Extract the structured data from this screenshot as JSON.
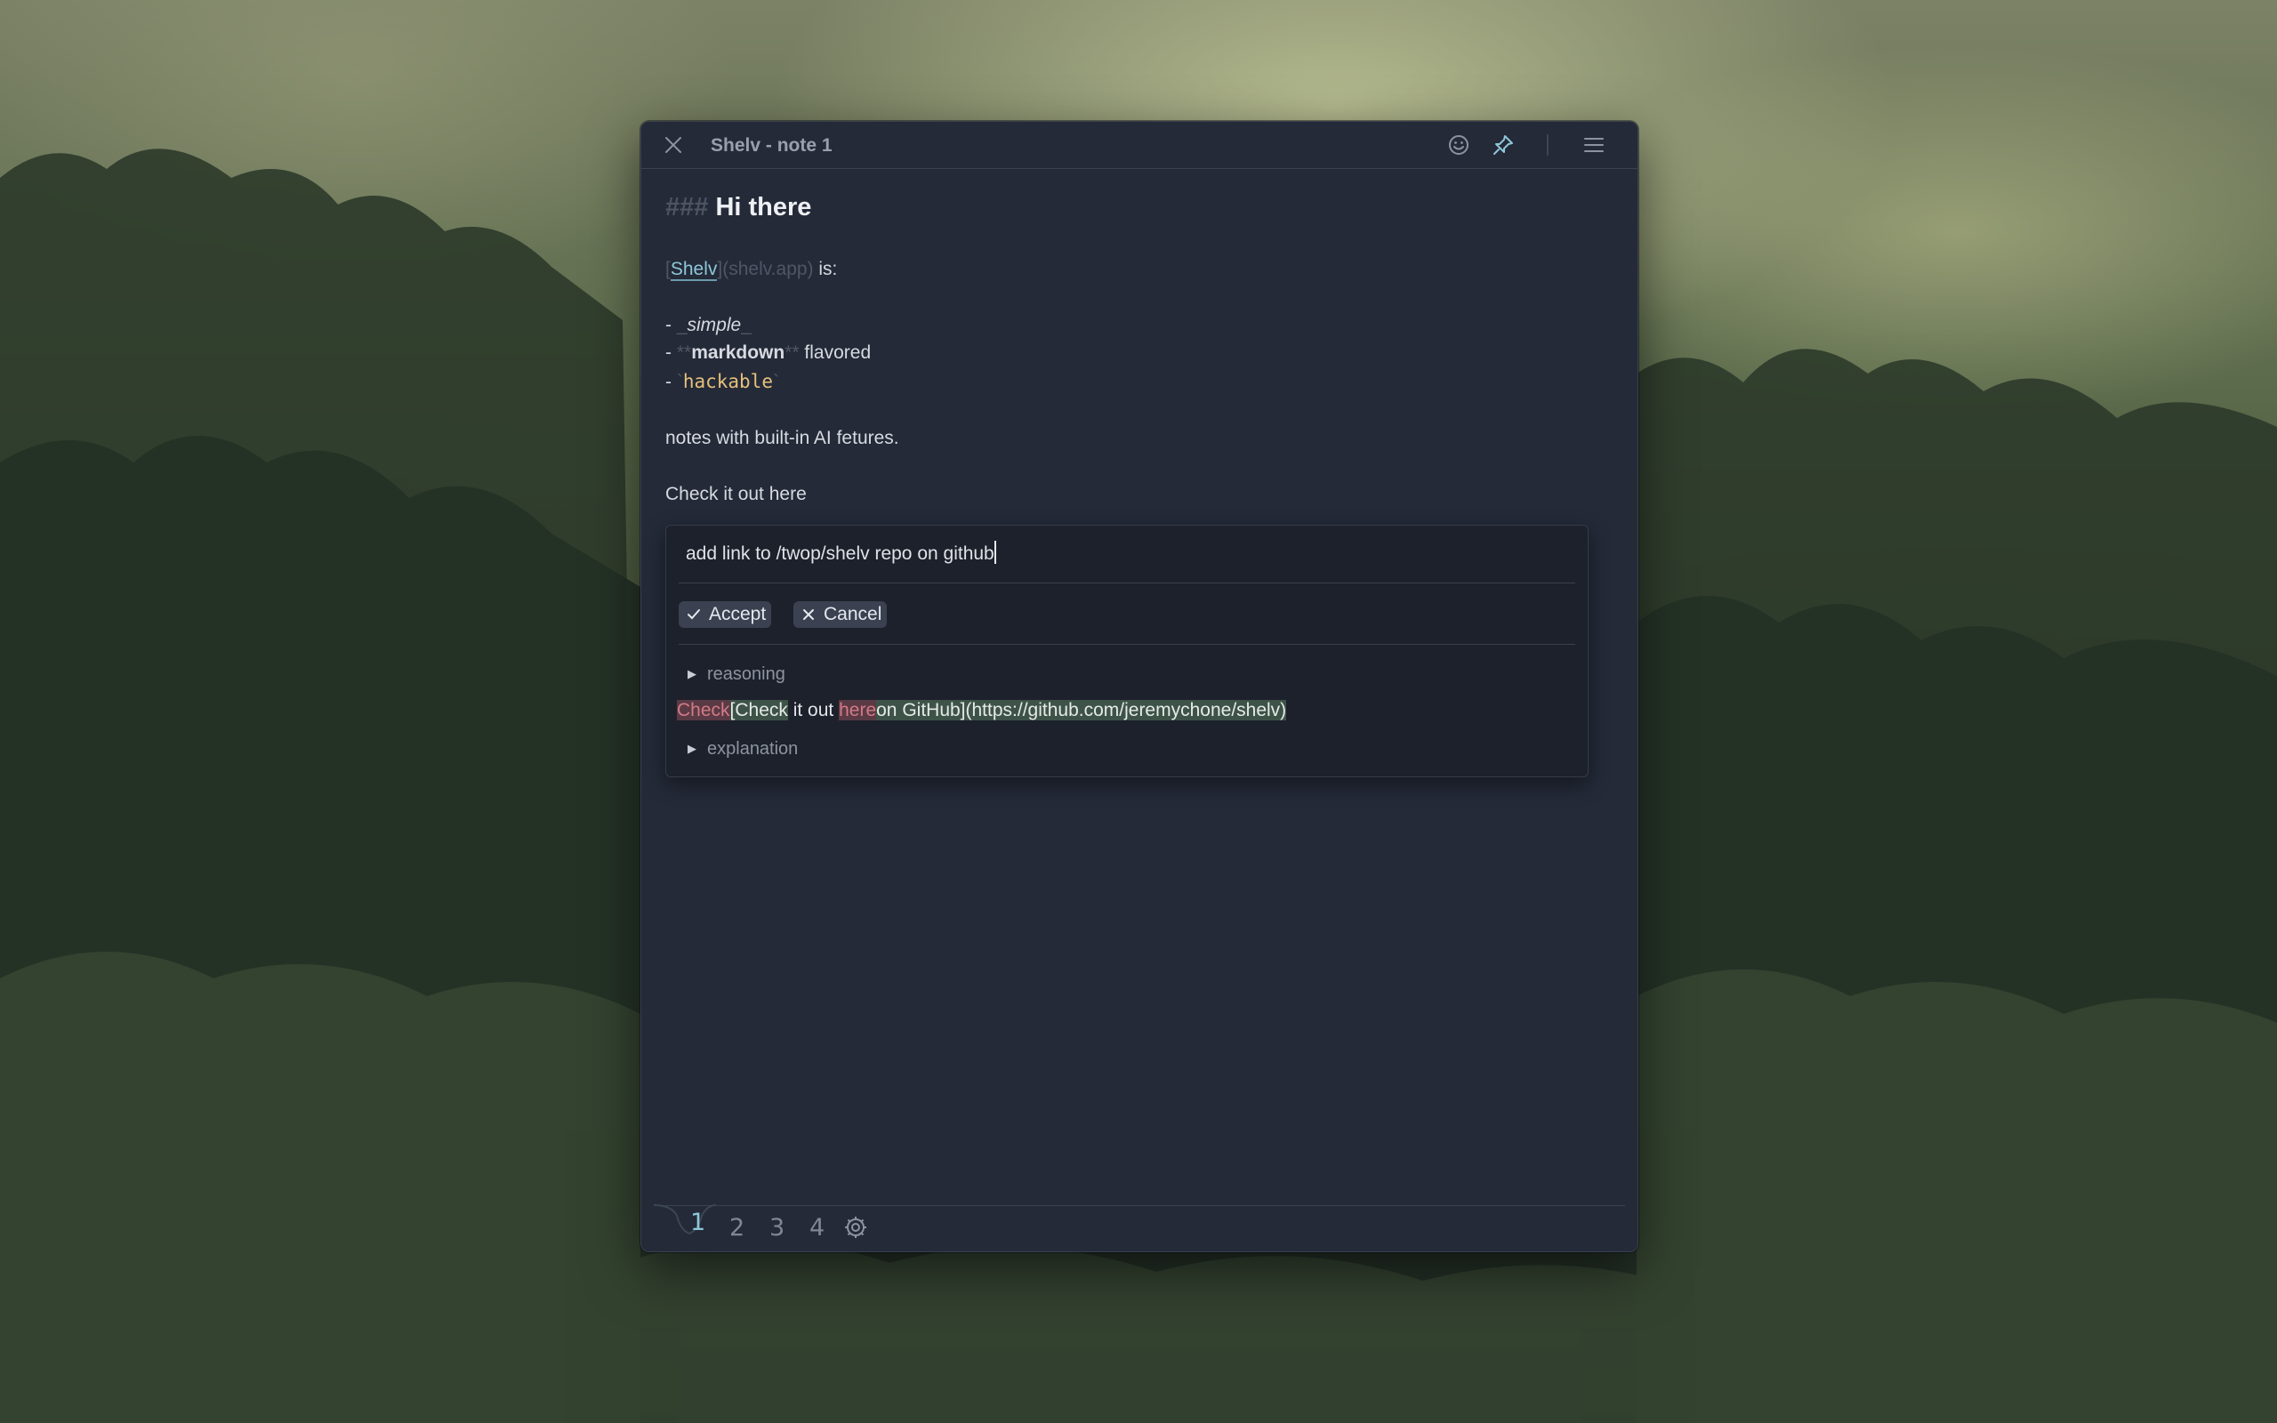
{
  "window": {
    "title": "Shelv - note 1"
  },
  "note": {
    "heading_marker": "###",
    "heading_text": "Hi there",
    "link_open": "[",
    "link_text": "Shelv",
    "link_close": "]",
    "link_url": "(shelv.app)",
    "link_suffix": " is:",
    "items": [
      {
        "bullet": "- ",
        "pre": "_",
        "text": "simple",
        "post": "_"
      },
      {
        "bullet": "- ",
        "pre": "**",
        "text": "markdown",
        "post": "**",
        "suffix": " flavored"
      },
      {
        "bullet": "- ",
        "pre": "`",
        "text": "hackable",
        "post": "`"
      }
    ],
    "paragraph": "notes with built-in AI fetures.",
    "check_line": "Check it out here"
  },
  "ai": {
    "prompt": "add link to /twop/shelv repo on github",
    "accept_label": "Accept",
    "cancel_label": "Cancel",
    "reasoning_label": "reasoning",
    "explanation_label": "explanation",
    "diff": [
      {
        "type": "del",
        "text": "Check"
      },
      {
        "type": "add",
        "text": "[Check"
      },
      {
        "type": "same",
        "text": " it out "
      },
      {
        "type": "del",
        "text": "here"
      },
      {
        "type": "add",
        "text": "on GitHub](https://github.com/jeremychone/shelv)"
      }
    ]
  },
  "tabs": [
    "1",
    "2",
    "3",
    "4"
  ],
  "active_tab": "1",
  "colors": {
    "accent": "#8ec7d8",
    "deleted": "#d27a86",
    "inline_code": "#e6c07b"
  }
}
